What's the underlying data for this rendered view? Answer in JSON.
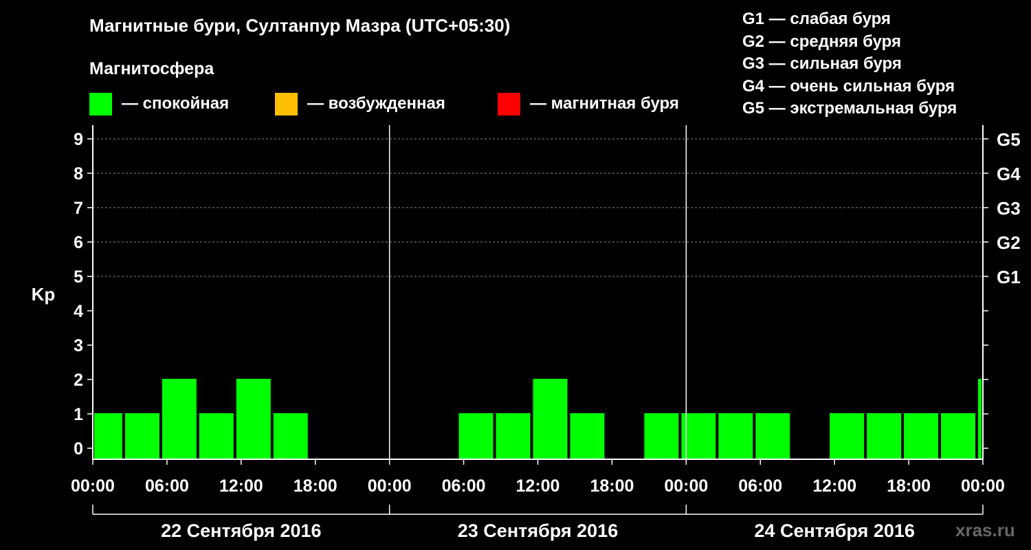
{
  "chart_data": {
    "type": "bar",
    "title": "Магнитные бури, Султанпур Мазра (UTC+05:30)",
    "subtitle": "Магнитосфера",
    "ylabel": "Kp",
    "ylim": [
      0,
      9
    ],
    "yticks": [
      "0",
      "1",
      "2",
      "3",
      "4",
      "5",
      "6",
      "7",
      "8",
      "9"
    ],
    "storm_ticks": [
      {
        "kp": 5,
        "label": "G1"
      },
      {
        "kp": 6,
        "label": "G2"
      },
      {
        "kp": 7,
        "label": "G3"
      },
      {
        "kp": 8,
        "label": "G4"
      },
      {
        "kp": 9,
        "label": "G5"
      }
    ],
    "xticks": [
      "00:00",
      "06:00",
      "12:00",
      "18:00",
      "00:00",
      "06:00",
      "12:00",
      "18:00",
      "00:00",
      "06:00",
      "12:00",
      "18:00",
      "00:00"
    ],
    "days": [
      "22 Сентября 2016",
      "23 Сентября 2016",
      "24 Сентября 2016"
    ],
    "legend": [
      {
        "label": "— спокойная",
        "color": "#00ff00"
      },
      {
        "label": "— возбужденная",
        "color": "#ffbf00"
      },
      {
        "label": "— магнитная буря",
        "color": "#ff0000"
      }
    ],
    "storm_legend": [
      "G1 — слабая буря",
      "G2 — средняя буря",
      "G3 — сильная буря",
      "G4 — очень сильная буря",
      "G5 — экстремальная буря"
    ],
    "grid": true,
    "bars": [
      {
        "start_hour": 0,
        "end_hour": 2.5,
        "kp": 1
      },
      {
        "start_hour": 2.5,
        "end_hour": 5.5,
        "kp": 1
      },
      {
        "start_hour": 5.5,
        "end_hour": 8.5,
        "kp": 2
      },
      {
        "start_hour": 8.5,
        "end_hour": 11.5,
        "kp": 1
      },
      {
        "start_hour": 11.5,
        "end_hour": 14.5,
        "kp": 2
      },
      {
        "start_hour": 14.5,
        "end_hour": 17.5,
        "kp": 1
      },
      {
        "start_hour": 17.5,
        "end_hour": 20.5,
        "kp": 0
      },
      {
        "start_hour": 20.5,
        "end_hour": 23.5,
        "kp": 0
      },
      {
        "start_hour": 23.5,
        "end_hour": 26.5,
        "kp": 0
      },
      {
        "start_hour": 26.5,
        "end_hour": 29.5,
        "kp": 0
      },
      {
        "start_hour": 29.5,
        "end_hour": 32.5,
        "kp": 1
      },
      {
        "start_hour": 32.5,
        "end_hour": 35.5,
        "kp": 1
      },
      {
        "start_hour": 35.5,
        "end_hour": 38.5,
        "kp": 2
      },
      {
        "start_hour": 38.5,
        "end_hour": 41.5,
        "kp": 1
      },
      {
        "start_hour": 41.5,
        "end_hour": 44.5,
        "kp": 0
      },
      {
        "start_hour": 44.5,
        "end_hour": 47.5,
        "kp": 1
      },
      {
        "start_hour": 47.5,
        "end_hour": 50.5,
        "kp": 1
      },
      {
        "start_hour": 50.5,
        "end_hour": 53.5,
        "kp": 1
      },
      {
        "start_hour": 53.5,
        "end_hour": 56.5,
        "kp": 1
      },
      {
        "start_hour": 56.5,
        "end_hour": 59.5,
        "kp": 0
      },
      {
        "start_hour": 59.5,
        "end_hour": 62.5,
        "kp": 1
      },
      {
        "start_hour": 62.5,
        "end_hour": 65.5,
        "kp": 1
      },
      {
        "start_hour": 65.5,
        "end_hour": 68.5,
        "kp": 1
      },
      {
        "start_hour": 68.5,
        "end_hour": 71.5,
        "kp": 1
      },
      {
        "start_hour": 71.5,
        "end_hour": 72,
        "kp": 2
      }
    ]
  },
  "watermark": "xras.ru"
}
